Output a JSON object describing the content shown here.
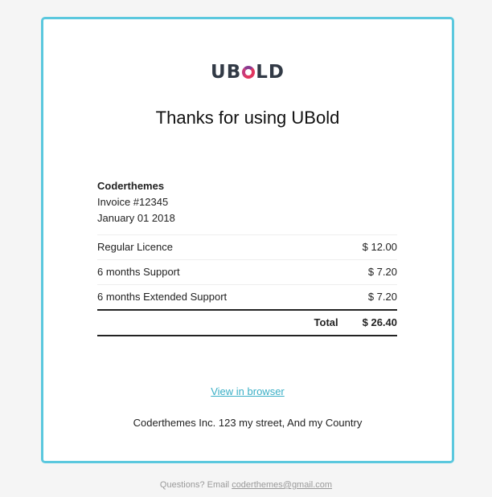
{
  "brand": {
    "logo_prefix": "UB",
    "logo_suffix": "LD"
  },
  "email": {
    "heading": "Thanks for using UBold",
    "company": "Coderthemes",
    "invoice_number": "Invoice #12345",
    "date": "January 01 2018",
    "items": [
      {
        "name": "Regular Licence",
        "price": "$ 12.00"
      },
      {
        "name": "6 months Support",
        "price": "$ 7.20"
      },
      {
        "name": "6 months Extended Support",
        "price": "$ 7.20"
      }
    ],
    "total_label": "Total",
    "total_value": "$ 26.40",
    "view_in_browser": "View in browser",
    "address": "Coderthemes Inc. 123 my street, And my Country"
  },
  "footer": {
    "question_text": "Questions? Email ",
    "email_link": "coderthemes@gmail.com"
  },
  "colors": {
    "page_background": "#f5f5f5",
    "card_border": "#5bc8de",
    "link": "#3aafc6",
    "logo_ring_a": "#e0365f",
    "logo_ring_b": "#8a3a8f"
  }
}
